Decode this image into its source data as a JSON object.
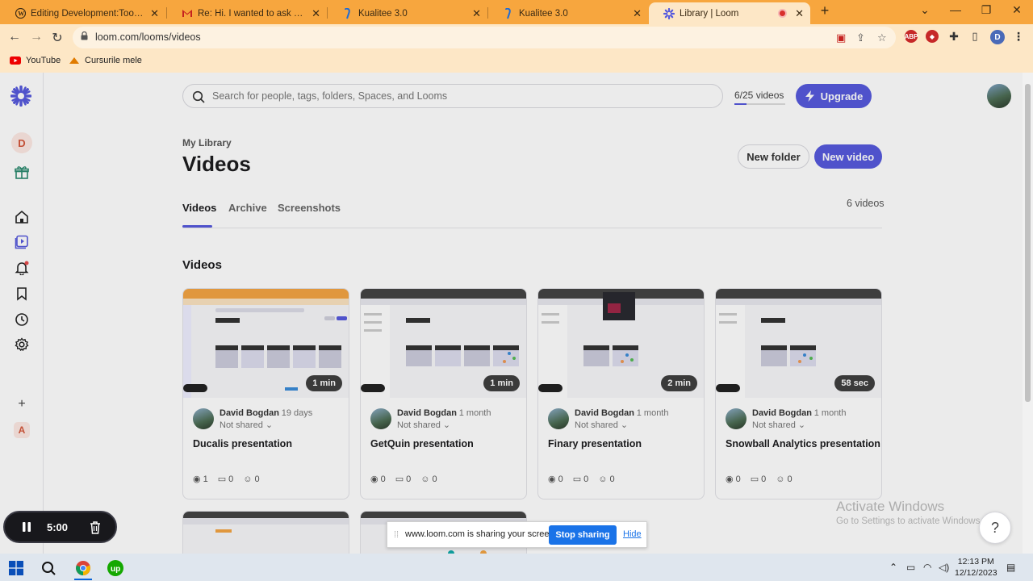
{
  "browser": {
    "tabs": [
      {
        "title": "Editing Development:Tools/Tean",
        "icon": "wordpress-icon"
      },
      {
        "title": "Re: Hi. I wanted to ask about the",
        "icon": "gmail-icon"
      },
      {
        "title": "Kualitee 3.0",
        "icon": "kualitee-icon"
      },
      {
        "title": "Kualitee 3.0",
        "icon": "kualitee-icon"
      },
      {
        "title": "Library | Loom",
        "icon": "loom-icon"
      }
    ],
    "url": "loom.com/looms/videos",
    "bookmarks": [
      {
        "label": "YouTube"
      },
      {
        "label": "Cursurile mele"
      }
    ],
    "profile_initial": "D",
    "ext_abp": "ABP"
  },
  "sidebar": {
    "workspace_initial": "D",
    "add_label": "+",
    "account_initial": "A"
  },
  "header": {
    "search_placeholder": "Search for people, tags, folders, Spaces, and Looms",
    "quota_text": "6/25 videos",
    "quota_fraction": 0.24,
    "upgrade_label": "Upgrade"
  },
  "main": {
    "breadcrumb": "My Library",
    "title": "Videos",
    "new_folder_label": "New folder",
    "new_video_label": "New video",
    "tabs": [
      "Videos",
      "Archive",
      "Screenshots"
    ],
    "video_count": "6 videos",
    "section_title": "Videos",
    "videos": [
      {
        "author": "David Bogdan",
        "age": "19 days",
        "share": "Not shared",
        "title": "Ducalis presentation",
        "duration": "1 min",
        "views": "1",
        "comments": "0",
        "reactions": "0"
      },
      {
        "author": "David Bogdan",
        "age": "1 month",
        "share": "Not shared",
        "title": "GetQuin presentation",
        "duration": "1 min",
        "views": "0",
        "comments": "0",
        "reactions": "0"
      },
      {
        "author": "David Bogdan",
        "age": "1 month",
        "share": "Not shared",
        "title": "Finary presentation",
        "duration": "2 min",
        "views": "0",
        "comments": "0",
        "reactions": "0"
      },
      {
        "author": "David Bogdan",
        "age": "1 month",
        "share": "Not shared",
        "title": "Snowball Analytics presentation",
        "duration": "58 sec",
        "views": "0",
        "comments": "0",
        "reactions": "0"
      }
    ]
  },
  "recorder": {
    "time": "5:00"
  },
  "sharebar": {
    "text": "www.loom.com is sharing your screen.",
    "stop_label": "Stop sharing",
    "hide_label": "Hide"
  },
  "watermark": {
    "line1": "Activate Windows",
    "line2": "Go to Settings to activate Windows."
  },
  "help_label": "?",
  "taskbar": {
    "time": "12:13 PM",
    "date": "12/12/2023"
  },
  "colors": {
    "accent": "#565add",
    "tabbar": "#f7a63e",
    "chrome_light": "#fde7c6"
  }
}
